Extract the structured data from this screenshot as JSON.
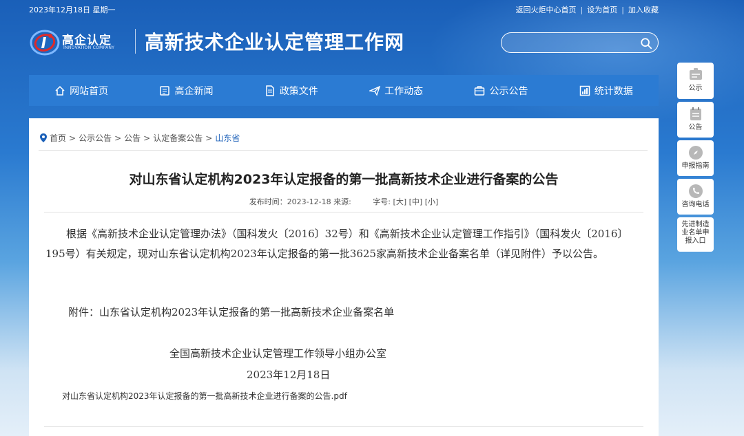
{
  "topbar": {
    "date": "2023年12月18日 星期一",
    "links": [
      "返回火炬中心首页",
      "设为首页",
      "加入收藏"
    ]
  },
  "logo": {
    "name": "高企认定",
    "sub": "INNOVATION COMPANY"
  },
  "site_title": "高新技术企业认定管理工作网",
  "search": {
    "value": "",
    "placeholder": ""
  },
  "nav": [
    {
      "label": "网站首页",
      "icon": "home-icon"
    },
    {
      "label": "高企新闻",
      "icon": "news-icon"
    },
    {
      "label": "政策文件",
      "icon": "document-icon"
    },
    {
      "label": "工作动态",
      "icon": "paper-plane-icon"
    },
    {
      "label": "公示公告",
      "icon": "briefcase-icon"
    },
    {
      "label": "统计数据",
      "icon": "chart-icon"
    }
  ],
  "breadcrumb": [
    "首页",
    "公示公告",
    "公告",
    "认定备案公告",
    "山东省"
  ],
  "article": {
    "title": "对山东省认定机构2023年认定报备的第一批高新技术企业进行备案的公告",
    "meta_time_label": "发布时间：2023-12-18 来源:",
    "meta_size_label": "字号:",
    "size_large": "[大]",
    "size_medium": "[中]",
    "size_small": "[小]",
    "body": "根据《高新技术企业认定管理办法》（国科发火〔2016〕32号）和《高新技术企业认定管理工作指引》（国科发火〔2016〕195号）有关规定，现对山东省认定机构2023年认定报备的第一批3625家高新技术企业备案名单（详见附件）予以公告。",
    "attachment": "附件：山东省认定机构2023年认定报备的第一批高新技术企业备案名单",
    "sign_org": "全国高新技术企业认定管理工作领导小组办公室",
    "sign_date": "2023年12月18日",
    "pdf": "对山东省认定机构2023年认定报备的第一批高新技术企业进行备案的公告.pdf"
  },
  "side": [
    {
      "label": "公示",
      "icon": "notice-board-icon"
    },
    {
      "label": "公告",
      "icon": "calendar-icon"
    },
    {
      "label": "申报指南",
      "icon": "compass-icon"
    },
    {
      "label": "咨询电话",
      "icon": "phone-icon"
    },
    {
      "label": "先进制造业名单申报入口"
    }
  ],
  "colors": {
    "nav_bg": "#2b7bd3",
    "accent": "#1a5fb8",
    "logo_red": "#e02a2a"
  }
}
